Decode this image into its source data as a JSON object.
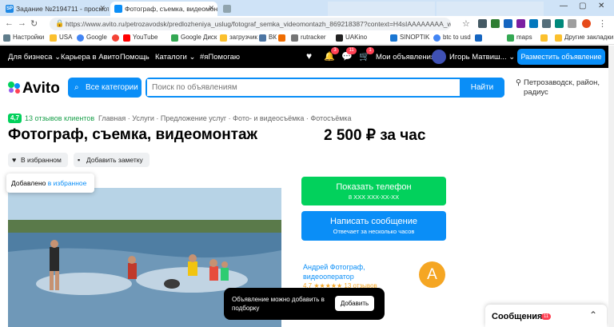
{
  "browser": {
    "tabs": [
      {
        "favicon": "SP",
        "title": "Задание №2194711 - просмотр з",
        "active": false
      },
      {
        "favicon": "A",
        "title": "Фотограф, съемка, видеомонтаж",
        "active": true
      },
      {
        "favicon": "",
        "title": "",
        "active": false
      }
    ],
    "url": "https://www.avito.ru/petrozavodsk/predlozheniya_uslug/fotograf_semka_videomontazh_869218387?context=H4sIAAAAAAAA_wE_AM...",
    "bookmarks": [
      "Настройки",
      "USA",
      "Google",
      "",
      "YouTube",
      "Google Диск",
      "загрузчик",
      "ВК",
      "",
      "rutracker",
      "UAKino",
      "SINOPTIK",
      "btc to usd",
      "",
      "maps",
      "",
      "Другие закладки"
    ]
  },
  "topnav": {
    "items": [
      "Для бизнеса",
      "Карьера в Авито",
      "Помощь",
      "Каталоги",
      "#яПомогаю"
    ],
    "badges": [
      "3",
      "11",
      "1"
    ],
    "my_ads": "Мои объявления",
    "user": "Игорь Матвиш...",
    "post_button": "Разместить объявление"
  },
  "search": {
    "logo": "Avito",
    "categories_button": "Все категории",
    "placeholder": "Поиск по объявлениям",
    "find_button": "Найти",
    "location": "Петрозаводск, район, радиус"
  },
  "listing": {
    "rating": "4,7",
    "reviews": "13 отзывов клиентов",
    "breadcrumbs": "Главная · Услуги · Предложение услуг · Фото- и видеосъёмка · Фотосъёмка",
    "title": "Фотограф, съемка, видеомонтаж",
    "price": "2 500 ₽ за час",
    "favorite_button": "В избранном",
    "note_button": "Добавить заметку",
    "tooltip_text": "Добавлено",
    "tooltip_link": "в избранное"
  },
  "contact": {
    "phone_button": "Показать телефон",
    "phone_masked": "8 XXX XXX-XX-XX",
    "message_button": "Написать сообщение",
    "message_sub": "Отвечает за несколько часов",
    "seller_name": "Андрей Фотограф, видеооператор",
    "seller_initial": "A",
    "seller_rating": "4,7 ★★★★★ 13 отзывов"
  },
  "toast": {
    "text": "Объявление можно добавить в подборку",
    "button": "Добавить"
  },
  "messages": {
    "label": "Сообщения",
    "count": "11"
  }
}
